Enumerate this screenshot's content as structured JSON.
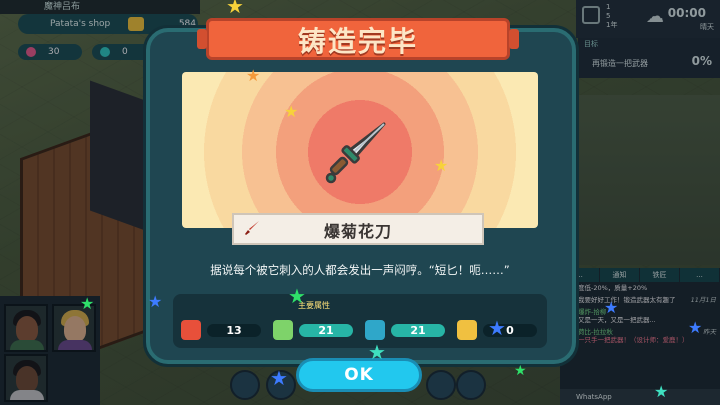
{
  "hud": {
    "name": "魔神吕布",
    "shop": "Patata's shop",
    "money": "584",
    "res_a": "30",
    "res_b": "0"
  },
  "top_right": {
    "date": "1\n5\n1年",
    "time": "00:00",
    "weather": "晴天",
    "goal_label": "目标",
    "goal_text": "再锻造一把武器",
    "goal_pct": "0%"
  },
  "modal": {
    "title": "铸造完毕",
    "weapon_name": "爆菊花刀",
    "description": "据说每个被它刺入的人都会发出一声闷哼。“短匕！呃……”",
    "stats_label": "主要属性",
    "stats": [
      {
        "icon": "attack-icon",
        "value": "13",
        "color": "#e8503a"
      },
      {
        "icon": "speed-icon",
        "value": "21",
        "color": "#7ed36a"
      },
      {
        "icon": "precision-icon",
        "value": "21",
        "color": "#2fa7c9"
      },
      {
        "icon": "magic-icon",
        "value": "0",
        "color": "#f0c040"
      }
    ],
    "ok_label": "OK"
  },
  "chat": {
    "tabs": [
      "...",
      "通知",
      "铁匠",
      "..."
    ],
    "messages": [
      {
        "who": "",
        "time": "",
        "text": "度低-20%，质量+20%",
        "hl": false
      },
      {
        "who": "",
        "time": "11月1日",
        "text": "我要好好工作！锻造武器太有趣了",
        "hl": false
      },
      {
        "who": "爆炸-拾柳",
        "time": "",
        "text": "又是一天，又是一把武器...",
        "hl": false
      },
      {
        "who": "荷比-拉拉秋",
        "time": "昨天",
        "text": "一只手一把武器！（设计师：爱鹿！）",
        "hl": true
      }
    ],
    "whatsapp": "WhatsApp"
  }
}
